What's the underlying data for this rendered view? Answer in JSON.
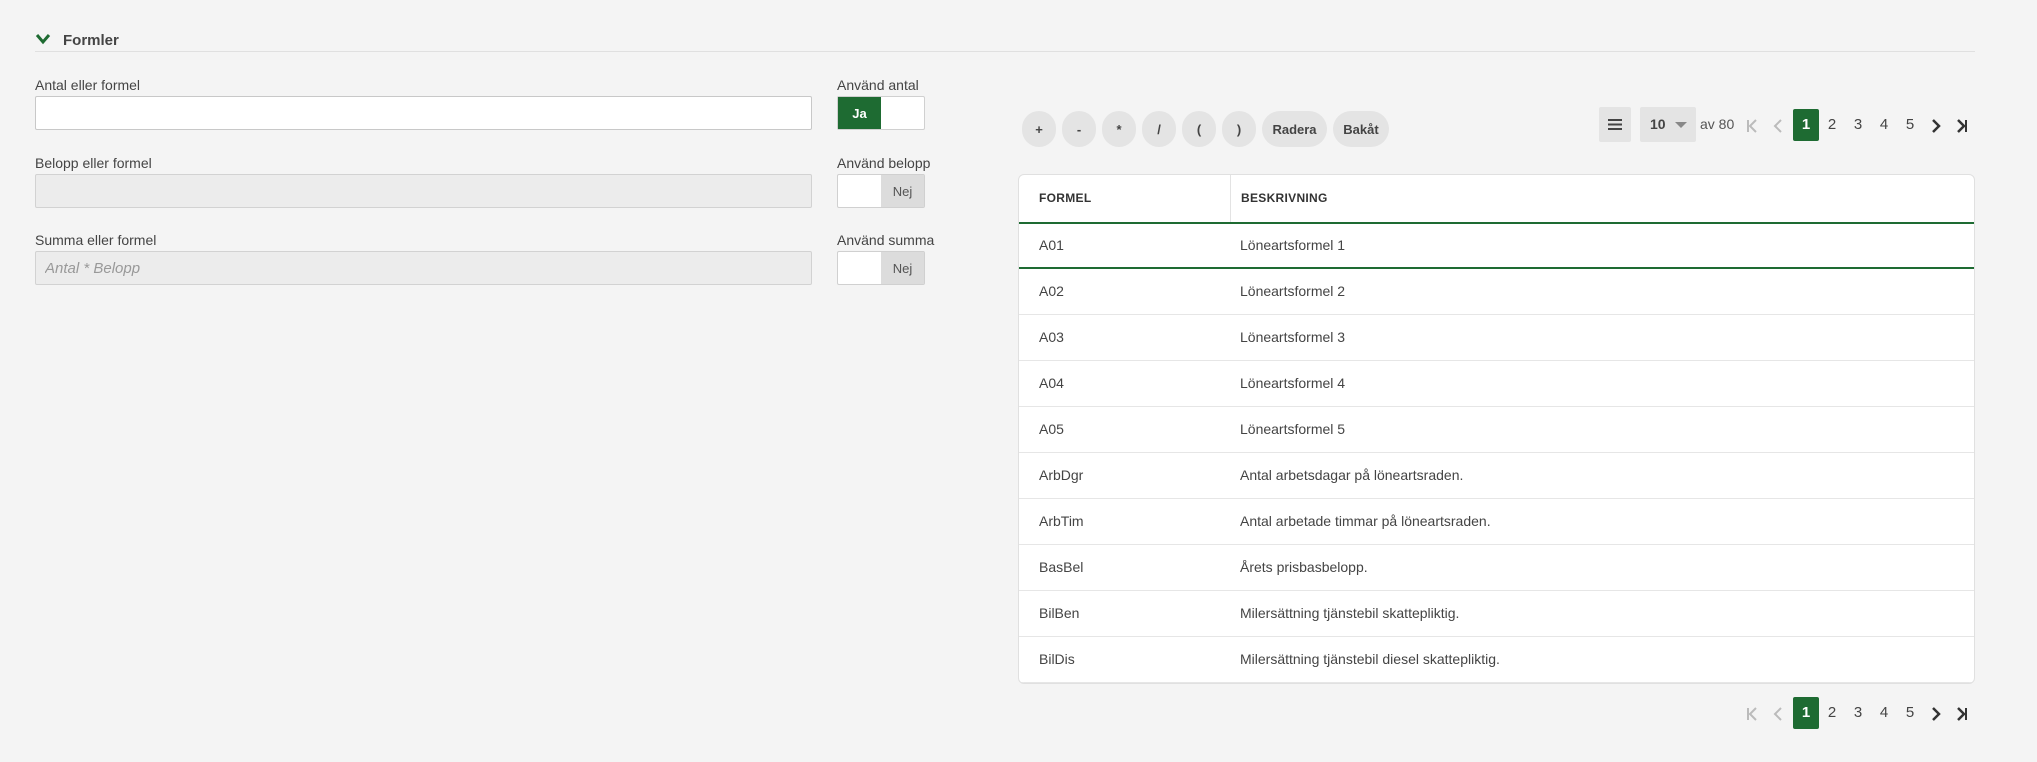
{
  "section": {
    "title": "Formler"
  },
  "fields": {
    "antal": {
      "label": "Antal eller formel",
      "value": "",
      "placeholder": ""
    },
    "belopp": {
      "label": "Belopp eller formel",
      "value": "",
      "placeholder": ""
    },
    "summa": {
      "label": "Summa eller formel",
      "value": "",
      "placeholder": "Antal * Belopp"
    }
  },
  "toggles": {
    "antal": {
      "label": "Använd antal",
      "text": "Ja",
      "state": "on"
    },
    "belopp": {
      "label": "Använd belopp",
      "text": "Nej",
      "state": "off"
    },
    "summa": {
      "label": "Använd summa",
      "text": "Nej",
      "state": "off"
    }
  },
  "operators": [
    "+",
    "-",
    "*",
    "/",
    "(",
    ")",
    "Radera",
    "Bakåt"
  ],
  "pager": {
    "page_size": "10",
    "of_text": "av 80",
    "pages": [
      "1",
      "2",
      "3",
      "4",
      "5"
    ],
    "current_page": "1"
  },
  "table": {
    "headers": [
      "FORMEL",
      "BESKRIVNING"
    ],
    "rows": [
      {
        "formel": "A01",
        "beskrivning": "Löneartsformel 1"
      },
      {
        "formel": "A02",
        "beskrivning": "Löneartsformel 2"
      },
      {
        "formel": "A03",
        "beskrivning": "Löneartsformel 3"
      },
      {
        "formel": "A04",
        "beskrivning": "Löneartsformel 4"
      },
      {
        "formel": "A05",
        "beskrivning": "Löneartsformel 5"
      },
      {
        "formel": "ArbDgr",
        "beskrivning": "Antal arbetsdagar på löneartsraden."
      },
      {
        "formel": "ArbTim",
        "beskrivning": "Antal arbetade timmar på löneartsraden."
      },
      {
        "formel": "BasBel",
        "beskrivning": "Årets prisbasbelopp."
      },
      {
        "formel": "BilBen",
        "beskrivning": "Milersättning tjänstebil skattepliktig."
      },
      {
        "formel": "BilDis",
        "beskrivning": "Milersättning tjänstebil diesel skattepliktig."
      }
    ],
    "selected_row": 0
  },
  "colors": {
    "accent": "#1e6b32",
    "background": "#f4f4f4"
  }
}
